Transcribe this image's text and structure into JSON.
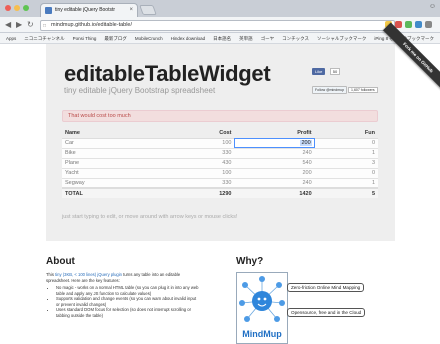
{
  "browser": {
    "tab_title": "tiny editable jQuery Bootstr",
    "url": "mindmup.github.io/editable-table/",
    "bookmarks": [
      "Apps",
      "ニコニコチャンネル",
      "Ponsi Thing",
      "最新ブログ",
      "MobileCrunch",
      "Hindex download",
      "日本語名",
      "英単語",
      "ゴーヤ",
      "コンチックス",
      "ソーシャルブックマーク",
      "iPing 8"
    ],
    "other_bookmarks": "その他のブックマーク"
  },
  "ribbon": {
    "label": "Fork me on GitHub"
  },
  "header": {
    "title": "editableTableWidget",
    "subtitle": "tiny editable jQuery Bootstrap spreadsheet"
  },
  "social": {
    "like_label": "Like",
    "like_count": "50",
    "follow_label": "Follow @mindmup",
    "followers": "1,607 followers"
  },
  "alert": {
    "text": "That would cost too much"
  },
  "table": {
    "headers": [
      "Name",
      "Cost",
      "Profit",
      "Fun"
    ],
    "rows": [
      [
        "Car",
        "100",
        "200",
        "0"
      ],
      [
        "Bike",
        "330",
        "240",
        "1"
      ],
      [
        "Plane",
        "430",
        "540",
        "3"
      ],
      [
        "Yacht",
        "100",
        "200",
        "0"
      ],
      [
        "Segway",
        "330",
        "240",
        "1"
      ]
    ],
    "footer": [
      "TOTAL",
      "1290",
      "1420",
      "5"
    ]
  },
  "hint": "just start typing to edit, or move around with arrow keys or mouse clicks!",
  "about": {
    "heading": "About",
    "intro_prefix": "This ",
    "intro_link": "tiny (3KB, < 100 lines) jQuery plugin",
    "intro_suffix": " turns any table into an editable spreadsheet. Here are the key features:",
    "features": [
      "No magic - works on a normal HTML table (so you can plug it in into any web table and apply any JS function to calculate values)",
      "Supports validation and change events (so you can warn about invalid input or prevent invalid changes)",
      "Uses standard DOM focus for selection (so does not interrupt scrolling or tabbing outside the table)"
    ]
  },
  "why": {
    "heading": "Why?",
    "logo_text": "MindMup",
    "nodes": [
      "Zero-friction Online Mind Mapping",
      "Opensource, free and in the Cloud"
    ]
  },
  "colors": {
    "jumbotron": "#eeeeee",
    "alert_text": "#b94a48",
    "selection": "#4d90fe",
    "link": "#2a6ebb"
  }
}
